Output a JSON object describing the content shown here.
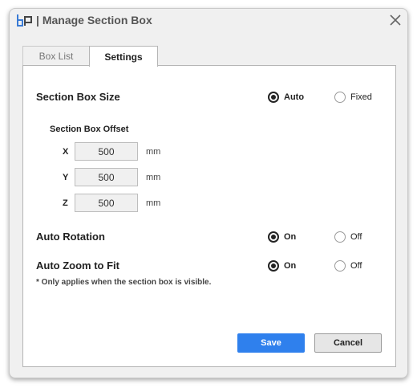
{
  "window": {
    "title": "Manage Section Box",
    "brand_color": "#3a7bd5"
  },
  "tabs": [
    {
      "label": "Box List",
      "active": false
    },
    {
      "label": "Settings",
      "active": true
    }
  ],
  "section_box_size": {
    "label": "Section Box Size",
    "options": [
      {
        "label": "Auto",
        "checked": true
      },
      {
        "label": "Fixed",
        "checked": false
      }
    ]
  },
  "offset": {
    "label": "Section Box Offset",
    "rows": [
      {
        "axis": "X",
        "value": "500",
        "unit": "mm"
      },
      {
        "axis": "Y",
        "value": "500",
        "unit": "mm"
      },
      {
        "axis": "Z",
        "value": "500",
        "unit": "mm"
      }
    ]
  },
  "auto_rotation": {
    "label": "Auto Rotation",
    "options": [
      {
        "label": "On",
        "checked": true
      },
      {
        "label": "Off",
        "checked": false
      }
    ]
  },
  "auto_zoom": {
    "label": "Auto Zoom to Fit",
    "options": [
      {
        "label": "On",
        "checked": true
      },
      {
        "label": "Off",
        "checked": false
      }
    ],
    "note": "* Only applies when the section box is visible."
  },
  "buttons": {
    "save": "Save",
    "cancel": "Cancel",
    "save_color": "#2f80ed"
  },
  "icons": {
    "logo": "app-logo-icon",
    "close": "close-icon"
  }
}
